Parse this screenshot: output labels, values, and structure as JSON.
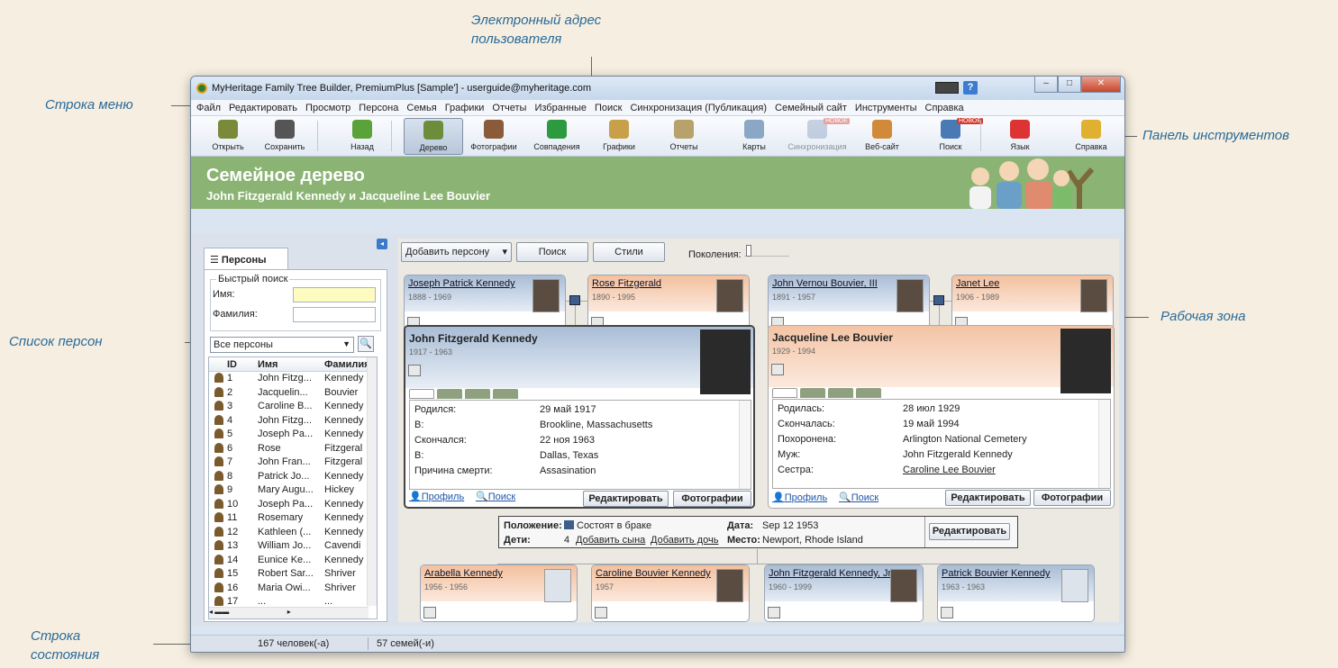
{
  "annotations": {
    "email": "Электронный адрес пользователя",
    "menu": "Строка меню",
    "toolbar": "Панель инструментов",
    "work": "Рабочая зона",
    "list": "Список персон",
    "status": "Строка состояния"
  },
  "window": {
    "title": "MyHeritage Family Tree Builder, PremiumPlus [Sample'] - userguide@myheritage.com"
  },
  "menu": [
    "Файл",
    "Редактировать",
    "Просмотр",
    "Персона",
    "Семья",
    "Графики",
    "Отчеты",
    "Избранные",
    "Поиск",
    "Синхронизация (Публикация)",
    "Семейный сайт",
    "Инструменты",
    "Справка"
  ],
  "toolbar": [
    {
      "label": "Открыть",
      "icon": "folder-icon",
      "color": "#7a8a3a"
    },
    {
      "label": "Сохранить",
      "icon": "floppy-icon",
      "color": "#555"
    },
    {
      "label": "Назад",
      "icon": "back-arrow-icon",
      "color": "#5aa23a"
    },
    {
      "label": "Дерево",
      "icon": "tree-icon",
      "color": "#6d8d3a"
    },
    {
      "label": "Фотографии",
      "icon": "photos-icon",
      "color": "#8a5b3a"
    },
    {
      "label": "Совпадения",
      "icon": "matches-icon",
      "color": "#2d9a3f"
    },
    {
      "label": "Графики",
      "icon": "charts-icon",
      "color": "#c8a04a"
    },
    {
      "label": "Отчеты",
      "icon": "reports-icon",
      "color": "#b6a26a"
    },
    {
      "label": "Карты",
      "icon": "map-icon",
      "color": "#8aa7c6"
    },
    {
      "label": "Синхронизация",
      "icon": "sync-icon",
      "color": "#8aa0c0"
    },
    {
      "label": "Веб-сайт",
      "icon": "website-icon",
      "color": "#d08a3a"
    },
    {
      "label": "Поиск",
      "icon": "search-icon",
      "color": "#4a7ab5"
    },
    {
      "label": "Язык",
      "icon": "flag-icon",
      "color": "#d33"
    },
    {
      "label": "Справка",
      "icon": "help-icon",
      "color": "#e0b030"
    }
  ],
  "badge_new": "НОВОЕ",
  "banner": {
    "title": "Семейное дерево",
    "subtitle": "John Fitzgerald Kennedy и Jacqueline Lee Bouvier"
  },
  "left": {
    "tab": "Персоны",
    "quick_search": "Быстрый поиск",
    "first_name": "Имя:",
    "last_name": "Фамилия:",
    "filter": "Все персоны",
    "cols": [
      "ID",
      "Имя",
      "Фамилия"
    ],
    "rows": [
      [
        "1",
        "John Fitzg...",
        "Kennedy"
      ],
      [
        "2",
        "Jacquelin...",
        "Bouvier"
      ],
      [
        "3",
        "Caroline B...",
        "Kennedy"
      ],
      [
        "4",
        "John Fitzg...",
        "Kennedy"
      ],
      [
        "5",
        "Joseph Pa...",
        "Kennedy"
      ],
      [
        "6",
        "Rose",
        "Fitzgeral"
      ],
      [
        "7",
        "John Fran...",
        "Fitzgeral"
      ],
      [
        "8",
        "Patrick Jo...",
        "Kennedy"
      ],
      [
        "9",
        "Mary Augu...",
        "Hickey"
      ],
      [
        "10",
        "Joseph Pa...",
        "Kennedy"
      ],
      [
        "11",
        "Rosemary",
        "Kennedy"
      ],
      [
        "12",
        "Kathleen (...",
        "Kennedy"
      ],
      [
        "13",
        "William Jo...",
        "Cavendi"
      ],
      [
        "14",
        "Eunice Ke...",
        "Kennedy"
      ],
      [
        "15",
        "Robert Sar...",
        "Shriver"
      ],
      [
        "16",
        "Maria Owi...",
        "Shriver"
      ],
      [
        "17",
        "...",
        "..."
      ]
    ]
  },
  "work": {
    "add_person": "Добавить персону",
    "search": "Поиск",
    "styles": "Стили",
    "generations": "Поколения:",
    "parents": [
      {
        "name": "Joseph Patrick Kennedy",
        "dates": "1888 - 1969",
        "sex": "m"
      },
      {
        "name": "Rose Fitzgerald",
        "dates": "1890 - 1995",
        "sex": "f"
      },
      {
        "name": "John Vernou Bouvier, III",
        "dates": "1891 - 1957",
        "sex": "m"
      },
      {
        "name": "Janet Lee",
        "dates": "1906 - 1989",
        "sex": "f"
      }
    ],
    "husband": {
      "name": "John Fitzgerald Kennedy",
      "dates": "1917 - 1963",
      "facts": [
        [
          "Родился:",
          "29 май 1917"
        ],
        [
          "В:",
          "Brookline, Massachusetts"
        ],
        [
          "Скончался:",
          "22 ноя 1963"
        ],
        [
          "В:",
          "Dallas, Texas"
        ],
        [
          "Причина смерти:",
          "Assasination"
        ]
      ]
    },
    "wife": {
      "name": "Jacqueline Lee Bouvier",
      "dates": "1929 - 1994",
      "facts": [
        [
          "Родилась:",
          "28 июл 1929"
        ],
        [
          "Скончалась:",
          "19 май 1994"
        ],
        [
          "Похоронена:",
          "Arlington National Cemetery"
        ],
        [
          "Муж:",
          "John Fitzgerald Kennedy"
        ],
        [
          "Сестра:",
          "Caroline Lee Bouvier"
        ]
      ]
    },
    "profile": "Профиль",
    "search_link": "Поиск",
    "edit": "Редактировать",
    "photos": "Фотографии",
    "marriage": {
      "status_label": "Положение:",
      "status": "Состоят в браке",
      "date_label": "Дата:",
      "date": "Sep 12 1953",
      "children_label": "Дети:",
      "children_count": "4",
      "add_son": "Добавить сына",
      "add_daughter": "Добавить дочь",
      "place_label": "Место:",
      "place": "Newport, Rhode Island",
      "edit": "Редактировать"
    },
    "children": [
      {
        "name": "Arabella Kennedy",
        "dates": "1956 - 1956",
        "sex": "f"
      },
      {
        "name": "Caroline Bouvier Kennedy",
        "dates": "1957",
        "sex": "f"
      },
      {
        "name": "John Fitzgerald Kennedy, Jr.",
        "dates": "1960 - 1999",
        "sex": "m"
      },
      {
        "name": "Patrick Bouvier Kennedy",
        "dates": "1963 - 1963",
        "sex": "m"
      }
    ]
  },
  "status": {
    "people": "167 человек(-а)",
    "families": "57 семей(-и)"
  }
}
